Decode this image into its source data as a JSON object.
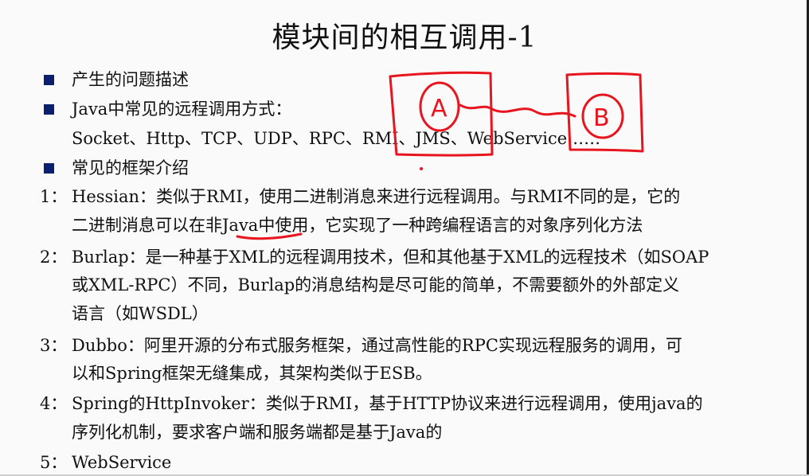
{
  "title": "模块间的相互调用-1",
  "bullets": [
    "产生的问题描述",
    "Java中常见的远程调用方式：",
    "常见的框架介绍"
  ],
  "protocols_line": "Socket、Http、TCP、UDP、RPC、RMI、JMS、WebService……",
  "items": [
    {
      "number": "1：",
      "lines": [
        "Hessian：类似于RMI，使用二进制消息来进行远程调用。与RMI不同的是，它的",
        "二进制消息可以在非Java中使用，它实现了一种跨编程语言的对象序列化方法"
      ]
    },
    {
      "number": "2：",
      "lines": [
        "Burlap：是一种基于XML的远程调用技术，但和其他基于XML的远程技术（如SOAP",
        "或XML-RPC）不同，Burlap的消息结构是尽可能的简单，不需要额外的外部定义",
        "语言（如WSDL）"
      ]
    },
    {
      "number": "3：",
      "lines": [
        "Dubbo：阿里开源的分布式服务框架，通过高性能的RPC实现远程服务的调用，可",
        "以和Spring框架无缝集成，其架构类似于ESB。"
      ]
    },
    {
      "number": "4：",
      "lines": [
        "Spring的HttpInvoker：类似于RMI，基于HTTP协议来进行远程调用，使用java的",
        "序列化机制，要求客户端和服务端都是基于Java的"
      ]
    },
    {
      "number": "5：",
      "lines": [
        "WebService"
      ]
    }
  ],
  "annotation": {
    "left_letter": "A",
    "right_letter": "B",
    "ink_color": "#e8141e"
  },
  "colors": {
    "bullet": "#0a1f6e",
    "text": "#111111",
    "background": "#fafafa"
  }
}
